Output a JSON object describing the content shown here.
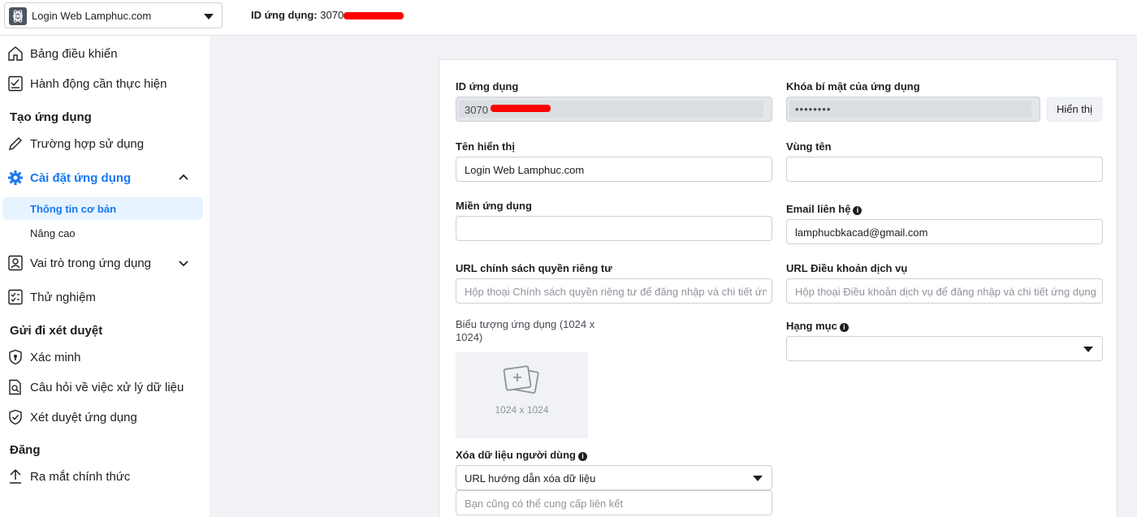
{
  "topbar": {
    "app_name": "Login Web Lamphuc.com",
    "app_id_label": "ID ứng dụng:",
    "app_id_value": "3070"
  },
  "sidebar": {
    "dashboard": "Bảng điều khiển",
    "required_actions": "Hành động cần thực hiện",
    "section_create": "Tạo ứng dụng",
    "use_cases": "Trường hợp sử dụng",
    "app_settings": "Cài đặt ứng dụng",
    "basic": "Thông tin cơ bản",
    "advanced": "Nâng cao",
    "app_roles": "Vai trò trong ứng dụng",
    "testing": "Thử nghiệm",
    "section_review": "Gửi đi xét duyệt",
    "verification": "Xác minh",
    "data_handling": "Câu hỏi về việc xử lý dữ liệu",
    "app_review": "Xét duyệt ứng dụng",
    "section_publish": "Đăng",
    "go_live": "Ra mắt chính thức"
  },
  "form": {
    "app_id_label": "ID ứng dụng",
    "app_id_value": "3070",
    "app_secret_label": "Khóa bí mật của ứng dụng",
    "app_secret_value": "••••••••",
    "show_button": "Hiển thị",
    "display_name_label": "Tên hiển thị",
    "display_name_value": "Login Web Lamphuc.com",
    "namespace_label": "Vùng tên",
    "namespace_value": "",
    "app_domains_label": "Miền ứng dụng",
    "app_domains_value": "",
    "contact_email_label": "Email liên hệ",
    "contact_email_value": "lamphucbkacad@gmail.com",
    "privacy_url_label": "URL chính sách quyền riêng tư",
    "privacy_url_placeholder": "Hộp thoại Chính sách quyền riêng tư để đăng nhập và chi tiết ứng dụng",
    "tos_url_label": "URL Điều khoản dịch vụ",
    "tos_url_placeholder": "Hộp thoại Điều khoản dịch vụ để đăng nhập và chi tiết ứng dụng",
    "app_icon_label": "Biểu tượng ứng dụng (1024 x 1024)",
    "app_icon_size": "1024 x 1024",
    "category_label": "Hạng mục",
    "category_value": "",
    "data_deletion_label": "Xóa dữ liệu người dùng",
    "data_deletion_select": "URL hướng dẫn xóa dữ liệu",
    "data_deletion_placeholder": "Bạn cũng có thể cung cấp liên kết"
  },
  "colors": {
    "accent": "#1877f2",
    "redaction": "#ff0000"
  }
}
